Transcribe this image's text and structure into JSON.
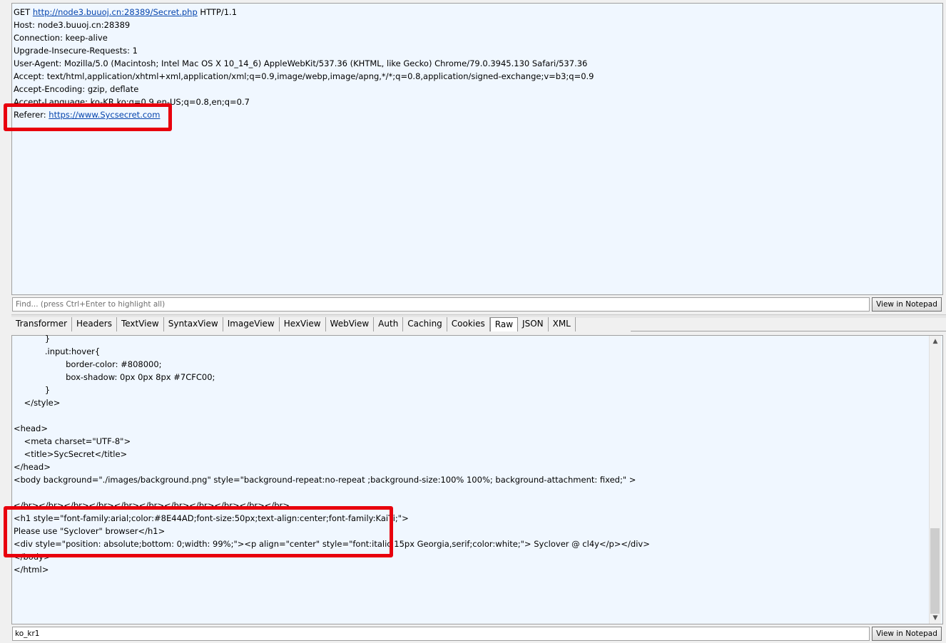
{
  "request": {
    "method": "GET ",
    "url": "http://node3.buuoj.cn:28389/Secret.php",
    "protocol": " HTTP/1.1",
    "headers": [
      "Host: node3.buuoj.cn:28389",
      "Connection: keep-alive",
      "Upgrade-Insecure-Requests: 1",
      "User-Agent: Mozilla/5.0 (Macintosh; Intel Mac OS X 10_14_6) AppleWebKit/537.36 (KHTML, like Gecko) Chrome/79.0.3945.130 Safari/537.36",
      "Accept: text/html,application/xhtml+xml,application/xml;q=0.9,image/webp,image/apng,*/*;q=0.8,application/signed-exchange;v=b3;q=0.9",
      "Accept-Encoding: gzip, deflate",
      "Accept-Language: ko-KR,ko;q=0.9,en-US;q=0.8,en;q=0.7"
    ],
    "referer_label": "Referer: ",
    "referer_url": "https://www.Sycsecret.com"
  },
  "find": {
    "placeholder": "Find... (press Ctrl+Enter to highlight all)",
    "notepad_label": "View in Notepad"
  },
  "tabs": [
    "Transformer",
    "Headers",
    "TextView",
    "SyntaxView",
    "ImageView",
    "HexView",
    "WebView",
    "Auth",
    "Caching",
    "Cookies",
    "Raw",
    "JSON",
    "XML"
  ],
  "active_tab": "Raw",
  "response": {
    "lines": [
      "            }",
      "            .input:hover{",
      "                    border-color: #808000;",
      "                    box-shadow: 0px 0px 8px #7CFC00;",
      "            }",
      "    </style>",
      "",
      "<head>",
      "    <meta charset=\"UTF-8\">",
      "    <title>SycSecret</title>",
      "</head>",
      "<body background=\"./images/background.png\" style=\"background-repeat:no-repeat ;background-size:100% 100%; background-attachment: fixed;\" >",
      "",
      "</br></br></br></br></br></br></br></br></br></br></br>",
      "<h1 style=\"font-family:arial;color:#8E44AD;font-size:50px;text-align:center;font-family:KaiTi;\">",
      "Please use \"Syclover\" browser</h1>",
      "<div style=\"position: absolute;bottom: 0;width: 99%;\"><p align=\"center\" style=\"font:italic 15px Georgia,serif;color:white;\"> Syclover @ cl4y</p></div>",
      "</body>",
      "</html>"
    ]
  },
  "bottom": {
    "value": "ko_kr1",
    "notepad_label": "View in Notepad"
  },
  "colors": {
    "highlight": "#e8000d",
    "pane_bg": "#f0f7ff",
    "link": "#0645ad"
  }
}
